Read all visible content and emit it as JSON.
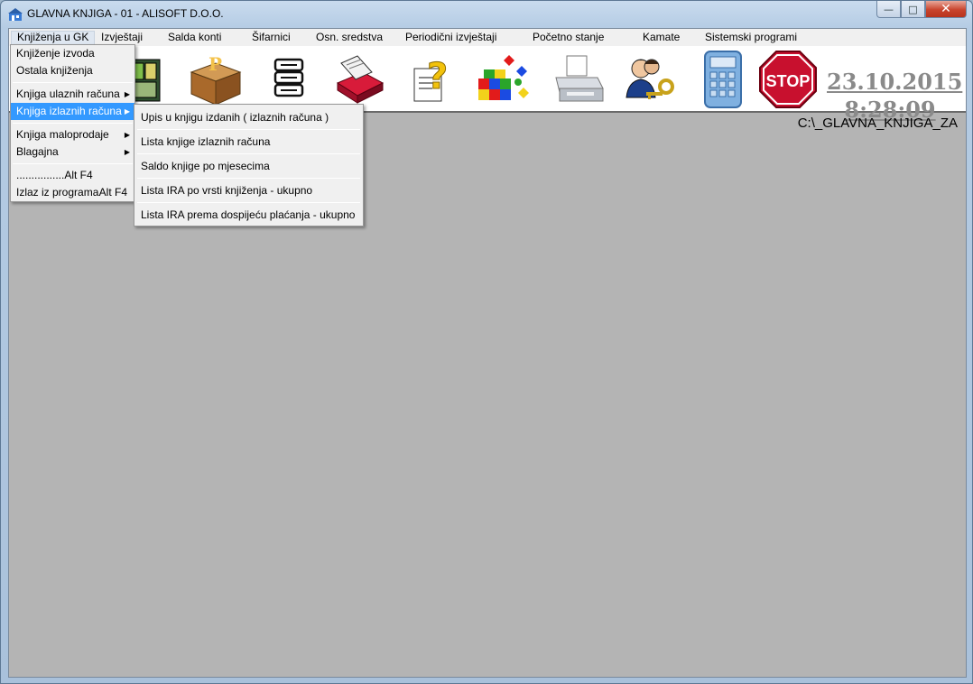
{
  "window": {
    "title": "GLAVNA KNJIGA - 01 - ALISOFT D.O.O."
  },
  "menubar": [
    "Knjiženja u GK",
    "Izvještaji",
    "Salda konti",
    "Šifarnici",
    "Osn. sredstva",
    "Periodični izvještaji",
    "Početno stanje",
    "Kamate",
    "Sistemski programi"
  ],
  "toolbar": {
    "icons": [
      "cabinet-icon",
      "package-icon",
      "server-icon",
      "card-file-icon",
      "help-document-icon",
      "color-cubes-icon",
      "printer-icon",
      "user-key-icon",
      "calculator-icon",
      "stop-icon"
    ],
    "stop_label": "STOP"
  },
  "clock": {
    "date": "23.10.2015",
    "time": "8:28:09"
  },
  "path": "C:\\_GLAVNA_KNJIGA_ZA",
  "dropdown": {
    "items": [
      "Knjiženje izvoda",
      "Ostala knjiženja",
      "Knjiga ulaznih računa",
      "Knjiga izlaznih računa",
      "Knjiga maloprodaje",
      "Blagajna",
      "................Alt F4",
      "Izlaz iz programa"
    ],
    "exit_shortcut": "Alt F4"
  },
  "submenu": {
    "items": [
      "Upis u knjigu izdanih ( izlaznih računa )",
      "Lista knjige izlaznih računa",
      "Saldo knjige po mjesecima",
      "Lista IRA po vrsti knjiženja - ukupno",
      "Lista IRA prema dospijeću plaćanja - ukupno"
    ]
  },
  "colors": {
    "highlight": "#3399ff",
    "workspace": "#b4b4b4",
    "clock": "#8a8a8a",
    "stop": "#c8102e"
  }
}
